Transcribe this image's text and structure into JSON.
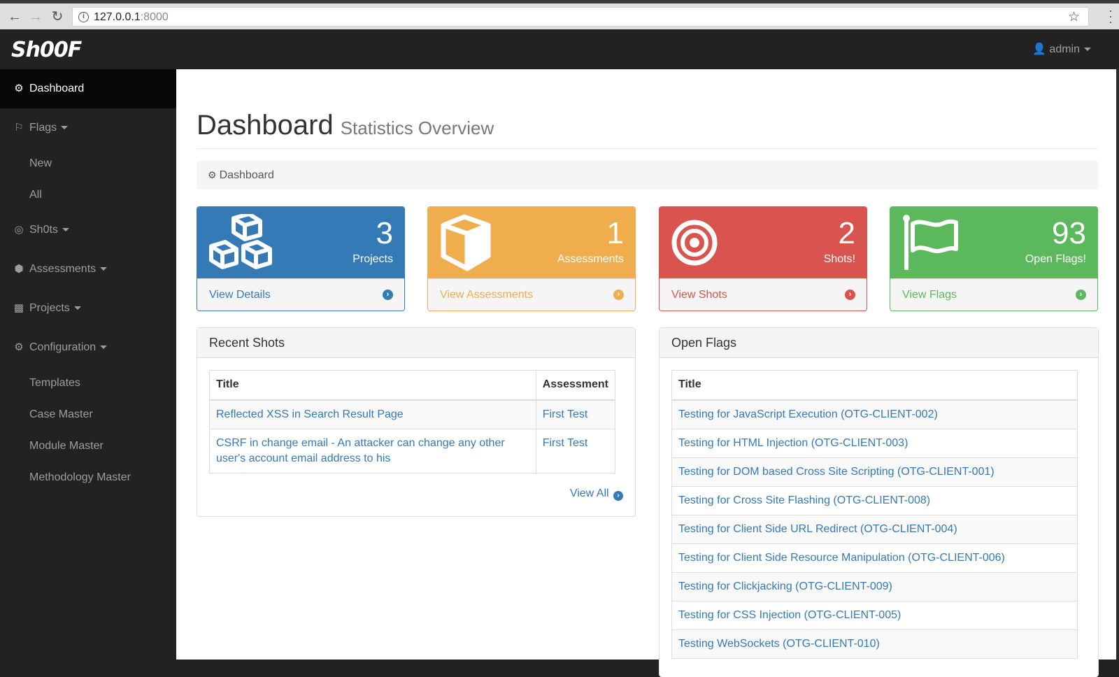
{
  "browser": {
    "url_host": "127.0.0.1",
    "url_port": ":8000"
  },
  "navbar": {
    "brand": "Sh00F",
    "user": "admin"
  },
  "sidebar": {
    "items": [
      {
        "label": "Dashboard",
        "icon": "dashboard-icon"
      },
      {
        "label": "Flags",
        "icon": "flag-icon",
        "sub": [
          "New",
          "All"
        ]
      },
      {
        "label": "Sh0ts",
        "icon": "bullseye-icon"
      },
      {
        "label": "Assessments",
        "icon": "cube-icon"
      },
      {
        "label": "Projects",
        "icon": "cubes-icon"
      },
      {
        "label": "Configuration",
        "icon": "gear-icon",
        "sub": [
          "Templates",
          "Case Master",
          "Module Master",
          "Methodology Master"
        ]
      }
    ]
  },
  "page": {
    "title": "Dashboard",
    "subtitle": "Statistics Overview",
    "breadcrumb": "Dashboard"
  },
  "stats": [
    {
      "count": "3",
      "label": "Projects",
      "link": "View Details",
      "color": "#337ab7",
      "icon": "cubes-icon"
    },
    {
      "count": "1",
      "label": "Assessments",
      "link": "View Assessments",
      "color": "#f0ad4e",
      "icon": "cube-icon"
    },
    {
      "count": "2",
      "label": "Shots!",
      "link": "View Shots",
      "color": "#d9534f",
      "icon": "bullseye-icon"
    },
    {
      "count": "93",
      "label": "Open Flags!",
      "link": "View Flags",
      "color": "#5cb85c",
      "icon": "flag-icon"
    }
  ],
  "recent_shots": {
    "heading": "Recent Shots",
    "columns": [
      "Title",
      "Assessment"
    ],
    "rows": [
      {
        "title": "Reflected XSS in Search Result Page",
        "assessment": "First Test"
      },
      {
        "title": "CSRF in change email - An attacker can change any other user's account email address to his",
        "assessment": "First Test"
      }
    ],
    "view_all": "View All"
  },
  "open_flags": {
    "heading": "Open Flags",
    "columns": [
      "Title"
    ],
    "rows": [
      "Testing for JavaScript Execution (OTG-CLIENT-002)",
      "Testing for HTML Injection (OTG-CLIENT-003)",
      "Testing for DOM based Cross Site Scripting (OTG-CLIENT-001)",
      "Testing for Cross Site Flashing (OTG-CLIENT-008)",
      "Testing for Client Side URL Redirect (OTG-CLIENT-004)",
      "Testing for Client Side Resource Manipulation (OTG-CLIENT-006)",
      "Testing for Clickjacking (OTG-CLIENT-009)",
      "Testing for CSS Injection (OTG-CLIENT-005)",
      "Testing WebSockets (OTG-CLIENT-010)"
    ]
  }
}
